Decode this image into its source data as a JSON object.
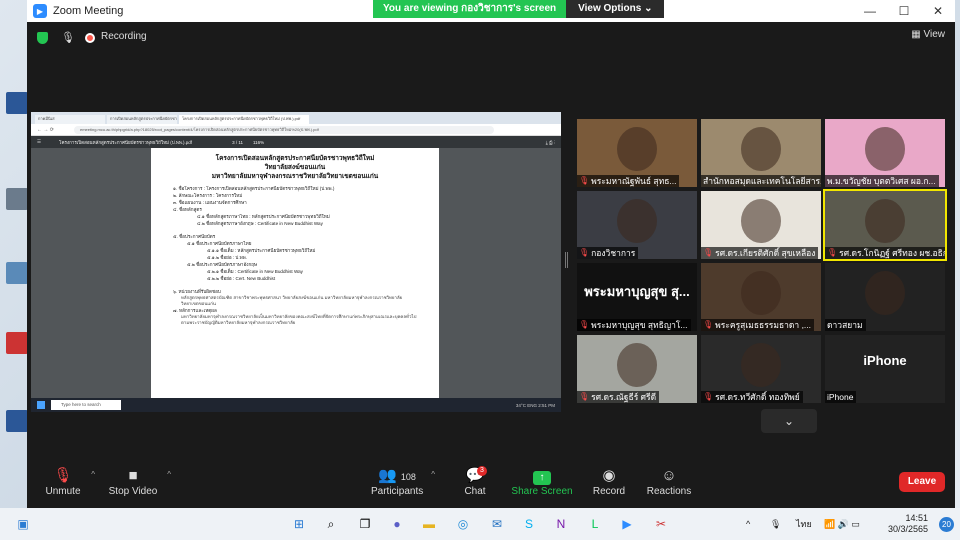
{
  "window": {
    "title": "Zoom Meeting"
  },
  "banner": {
    "viewing_text": "You are viewing กองวิชาการ's screen",
    "view_options": "View Options"
  },
  "topbar": {
    "recording_label": "Recording",
    "view_label": "View"
  },
  "shared_doc": {
    "tabs": [
      "กาคมีนิเส",
      "การเปิดสอนหลักสูตรประกาศนียบัตรชาวพุทธวิถีใหม่",
      "โครงการเปิดสอนหลักสูตรประกาศนียบัตรชาวพุทธวิถีใหม่ (ป.พพ.).pdf"
    ],
    "url": "emeeting.mcu.ac.th/phpgrid/a.php?18025/root_pages/content/4/โครงการเปิดสอนหลักสูตรประกาศนียบัตรชาวพุทธวิถีใหม่%20(ป.พพ.).pdf",
    "file_name": "โครงการเปิดสอนหลักสูตรประกาศนียบัตรชาวพุทธวิถีใหม่ (ป.พพ.).pdf",
    "page_indicator": "3 / 11",
    "zoom": "116%",
    "heading_lines": [
      "โครงการเปิดสอนหลักสูตรประกาศนียบัตรชาวพุทธวิถีใหม่",
      "วิทยาลัยสงฆ์ขอนแก่น",
      "มหาวิทยาลัยมหาจุฬาลงกรณราชวิทยาลัยวิทยาเขตขอนแก่น"
    ],
    "lines": [
      {
        "t": "๑. ชื่อโครงการ      : โครงการเปิดสอนหลักสูตรประกาศนียบัตรชาวพุทธวิถีใหม่ (ป.พพ.)",
        "lvl": 0
      },
      {
        "t": "๒. ลักษณะโครงการ    : โครงการใหม่",
        "lvl": 0
      },
      {
        "t": "๓. ชื่อแผนงาน       : แผนงานจัดการศึกษา",
        "lvl": 0
      },
      {
        "t": "๔. ชื่อหลักสูตร",
        "lvl": 0
      },
      {
        "t": "๔.๑ ชื่อหลักสูตรภาษาไทย : หลักสูตรประกาศนียบัตรชาวพุทธวิถีใหม่",
        "lvl": 2
      },
      {
        "t": "๔.๒ ชื่อหลักสูตรภาษาอังกฤษ : Certificate in New Buddhist Way",
        "lvl": 2
      },
      {
        "t": "",
        "lvl": 0
      },
      {
        "t": "๕. ชื่อประกาศนียบัตร",
        "lvl": 0
      },
      {
        "t": "๕.๑ ชื่อประกาศนียบัตรภาษาไทย",
        "lvl": 1
      },
      {
        "t": "๕.๑.๑ ชื่อเต็ม : หลักสูตรประกาศนียบัตรชาวพุทธวิถีใหม่",
        "lvl": 3
      },
      {
        "t": "๕.๑.๒ ชื่อย่อ : ป.พพ.",
        "lvl": 3
      },
      {
        "t": "๕.๒ ชื่อประกาศนียบัตรภาษาอังกฤษ",
        "lvl": 1
      },
      {
        "t": "๕.๒.๑ ชื่อเต็ม : Certificate in New Buddhist Way",
        "lvl": 3
      },
      {
        "t": "๕.๒.๒ ชื่อย่อ : Cert. New Buddhist",
        "lvl": 3
      },
      {
        "t": "",
        "lvl": 0
      },
      {
        "t": "๖. หน่วยงานที่รับผิดชอบ",
        "lvl": 0
      }
    ],
    "para1": "หลักสูตรพุทธศาสตรบัณฑิต สาขาวิชาพระพุทธศาสนา วิทยาลัยสงฆ์ขอนแก่น มหาวิทยาลัยมหาจุฬาลงกรณราชวิทยาลัย วิทยาเขตขอนแก่น",
    "section7": "๗. หลักการและเหตุผล",
    "para2": "มหาวิทยาลัยมหาจุฬาลงกรณราชวิทยาลัยเป็นมหาวิทยาลัยของคณะสงฆ์ไทยที่จัดการศึกษาแก่พระภิกษุสามเณรและบุคคลทั่วไป ตามพระราชบัญญัติมหาวิทยาลัยมหาจุฬาลงกรณราชวิทยาลัย",
    "search_placeholder": "Type here to search",
    "tray_text": "34°C  ENG  2:51 PM"
  },
  "participants": [
    {
      "name": "พระมหาณัฐพันธ์ สุทธ...",
      "muted": true,
      "speaking": false,
      "bg": "#7a5a3a",
      "bigtext": ""
    },
    {
      "name": "สำนักหอสมุดและเทคโนโลยีสาร...",
      "muted": false,
      "speaking": false,
      "bg": "#9c8a6e",
      "bigtext": ""
    },
    {
      "name": "พ.ม.ขวัญชัย บุตตวิเศส ผอ.ก...",
      "muted": false,
      "speaking": false,
      "bg": "#e9a8c8",
      "bigtext": ""
    },
    {
      "name": "กองวิชาการ",
      "muted": true,
      "speaking": false,
      "bg": "#3b3d44",
      "bigtext": ""
    },
    {
      "name": "รศ.ดร.เกียรติศักดิ์ สุขเหลือง",
      "muted": true,
      "speaking": false,
      "bg": "#e8e4dc",
      "bigtext": ""
    },
    {
      "name": "รศ.ดร.โกนิฏฐ์ ศรีทอง ผช.อธิก...",
      "muted": true,
      "speaking": true,
      "bg": "#5b5a4e",
      "bigtext": ""
    },
    {
      "name": "พระมหาบุญสุข สุทธิญาโ...",
      "muted": true,
      "speaking": false,
      "bg": "#111111",
      "bigtext": "พระมหาบุญสุข สุ..."
    },
    {
      "name": "พระครูสุเมธธรรมธาดา ,...",
      "muted": true,
      "speaking": false,
      "bg": "#4e3b2c",
      "bigtext": ""
    },
    {
      "name": "ดาวสยาม",
      "muted": false,
      "speaking": false,
      "bg": "#222222",
      "bigtext": ""
    },
    {
      "name": "รศ.ดร.ณัฐธีร์ ศรีดี",
      "muted": true,
      "speaking": false,
      "bg": "#a4a6a0",
      "bigtext": ""
    },
    {
      "name": "รศ.ดร.ทวีศักดิ์ ทองทิพย์",
      "muted": true,
      "speaking": false,
      "bg": "#2a2a2a",
      "bigtext": ""
    },
    {
      "name": "iPhone",
      "muted": false,
      "speaking": false,
      "bg": "#222222",
      "bigtext": "iPhone"
    }
  ],
  "toolbar": {
    "unmute": "Unmute",
    "stop_video": "Stop Video",
    "participants": "Participants",
    "participants_count": "108",
    "chat": "Chat",
    "chat_badge": "3",
    "share_screen": "Share Screen",
    "record": "Record",
    "reactions": "Reactions",
    "leave": "Leave"
  },
  "taskbar": {
    "time": "14:51",
    "date": "30/3/2565",
    "lang": "ไทย",
    "notifications": "20"
  },
  "colors": {
    "accent_green": "#23c552",
    "leave_red": "#e02828",
    "speaker_yellow": "#f2e600"
  }
}
